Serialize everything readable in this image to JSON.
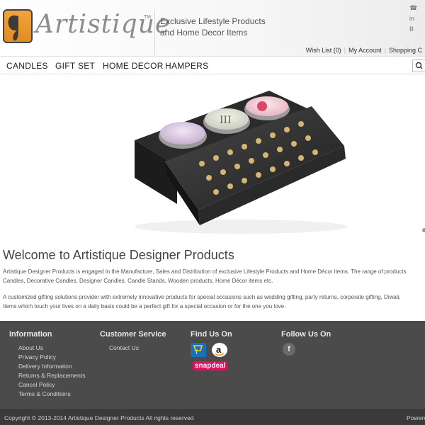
{
  "header": {
    "brand": "Artistique",
    "tm": "TM",
    "tagline_line1": "Exclusive Lifestyle Products",
    "tagline_line2": "and Home Decor Items",
    "contact_line1": "☎",
    "contact_line2": "in",
    "contact_line3": "B",
    "wishlist": "Wish List (0)",
    "my_account": "My Account",
    "shopping": "Shopping C"
  },
  "nav": {
    "items": [
      "CANDLES",
      "GIFT SET",
      "HOME DECOR",
      "HAMPERS"
    ]
  },
  "welcome": {
    "title": "Welcome to Artistique Designer Products",
    "p1_line1": "Artistique Designer Products is engaged in the Manufacture, Sales and Distribution of exclusive Lifestyle Products and Home Décor items. The range of products",
    "p1_line2": "Candles, Decorative Candles, Designer Candles, Candle Stands, Wooden products, Home Décor items etc.",
    "p2_line1": "A customized gifting solutions provider with extremely innovative products for special occasions such as wedding gifting, party returns, corporate gifting, Diwali,",
    "p2_line2": "Items which touch your lives on a daily basis could be a perfect gift for a special occasion or for the one you love."
  },
  "footer": {
    "information": {
      "title": "Information",
      "links": [
        "About Us",
        "Privacy Policy",
        "Delivery Information",
        "Returns & Replacements",
        "Cancel Policy",
        "Terms & Conditions"
      ]
    },
    "customer_service": {
      "title": "Customer Service",
      "links": [
        "Contact Us"
      ]
    },
    "find_us": {
      "title": "Find Us On",
      "snapdeal": "snapdeal"
    },
    "follow_us": {
      "title": "Follow Us On",
      "facebook": "f"
    },
    "copyright": "Copyright © 2013-2014 Artistique Designer Products All rights reserved",
    "powered": "Powere"
  },
  "colors": {
    "logo_orange": "#ed9a2c",
    "footer_bg": "#4b4b4b",
    "bottom_bar": "#3a3a3a"
  }
}
